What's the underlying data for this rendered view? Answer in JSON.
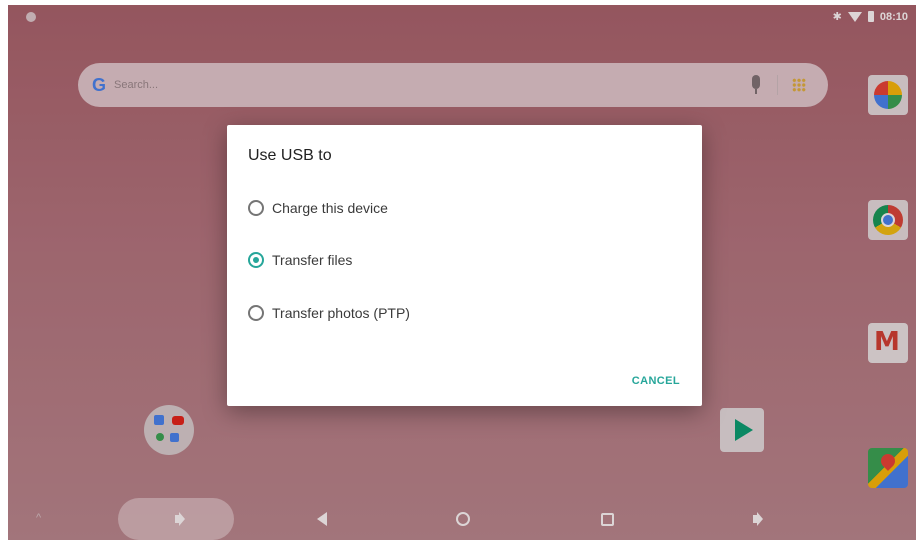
{
  "status_bar": {
    "time": "08:10",
    "icons": [
      "notification-dot-icon",
      "bluetooth-icon",
      "wifi-icon",
      "battery-icon"
    ]
  },
  "search": {
    "logo": "G",
    "placeholder": "Search..."
  },
  "dialog": {
    "title": "Use USB to",
    "options": [
      {
        "label": "Charge this device",
        "selected": false
      },
      {
        "label": "Transfer files",
        "selected": true
      },
      {
        "label": "Transfer photos (PTP)",
        "selected": false
      }
    ],
    "cancel_label": "CANCEL"
  },
  "home_icons": [
    "photos-icon",
    "chrome-icon",
    "gmail-icon",
    "maps-icon",
    "play-store-icon",
    "google-folder-icon"
  ],
  "nav_bar": [
    "volume-down-icon",
    "back-icon",
    "home-icon",
    "recents-icon",
    "volume-up-icon"
  ],
  "colors": {
    "accent": "#26a69a",
    "wallpaper": "#b27780"
  }
}
